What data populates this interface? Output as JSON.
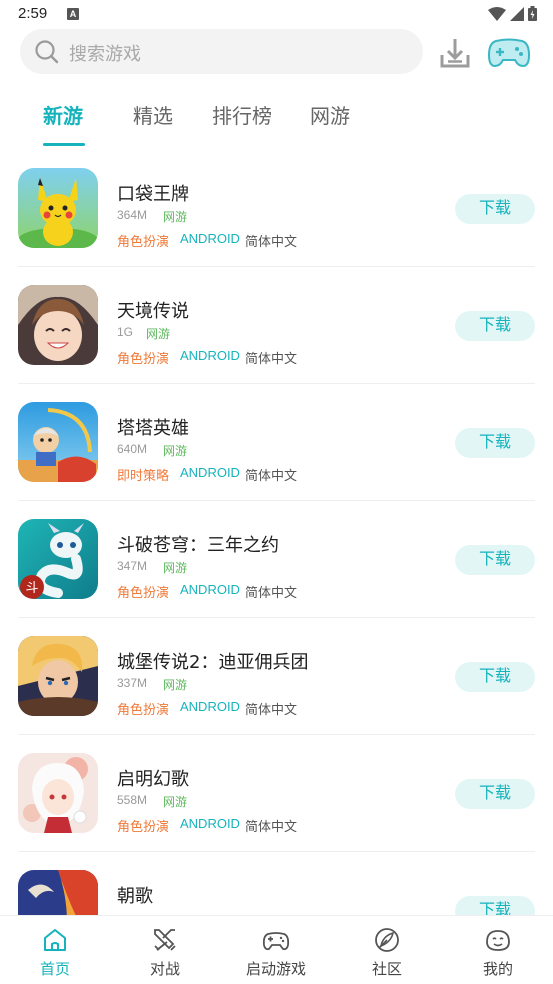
{
  "status": {
    "time": "2:59",
    "notif_glyph": "A"
  },
  "search": {
    "placeholder": "搜索游戏"
  },
  "colors": {
    "accent": "#16b3bd",
    "genre": "#f07a3a",
    "network": "#5fb85f",
    "button_bg": "#e3f6f6"
  },
  "tabs": [
    {
      "label": "新游",
      "active": true
    },
    {
      "label": "精选",
      "active": false
    },
    {
      "label": "排行榜",
      "active": false
    },
    {
      "label": "网游",
      "active": false
    }
  ],
  "games": [
    {
      "name": "口袋王牌",
      "size": "364M",
      "network": "网游",
      "genre": "角色扮演",
      "platform": "ANDROID",
      "language": "简体中文",
      "button": "下载",
      "icon": "pikachu-game-icon"
    },
    {
      "name": "天境传说",
      "size": "1G",
      "network": "网游",
      "genre": "角色扮演",
      "platform": "ANDROID",
      "language": "简体中文",
      "button": "下载",
      "icon": "anime-girl-game-icon"
    },
    {
      "name": "塔塔英雄",
      "size": "640M",
      "network": "网游",
      "genre": "即时策略",
      "platform": "ANDROID",
      "language": "简体中文",
      "button": "下载",
      "icon": "archer-hero-game-icon"
    },
    {
      "name": "斗破苍穹：三年之约",
      "size": "347M",
      "network": "网游",
      "genre": "角色扮演",
      "platform": "ANDROID",
      "language": "简体中文",
      "button": "下载",
      "icon": "serpent-game-icon"
    },
    {
      "name": "城堡传说2：迪亚佣兵团",
      "size": "337M",
      "network": "网游",
      "genre": "角色扮演",
      "platform": "ANDROID",
      "language": "简体中文",
      "button": "下载",
      "icon": "warrior-game-icon"
    },
    {
      "name": "启明幻歌",
      "size": "558M",
      "network": "网游",
      "genre": "角色扮演",
      "platform": "ANDROID",
      "language": "简体中文",
      "button": "下载",
      "icon": "white-hair-girl-game-icon"
    },
    {
      "name": "朝歌",
      "size": "",
      "network": "",
      "genre": "",
      "platform": "",
      "language": "",
      "button": "下载",
      "icon": "fire-warrior-game-icon"
    }
  ],
  "bottom_nav": [
    {
      "label": "首页",
      "icon": "home-icon",
      "active": true
    },
    {
      "label": "对战",
      "icon": "swords-icon",
      "active": false
    },
    {
      "label": "启动游戏",
      "icon": "gamepad-icon",
      "active": false
    },
    {
      "label": "社区",
      "icon": "feather-icon",
      "active": false
    },
    {
      "label": "我的",
      "icon": "face-icon",
      "active": false
    }
  ]
}
